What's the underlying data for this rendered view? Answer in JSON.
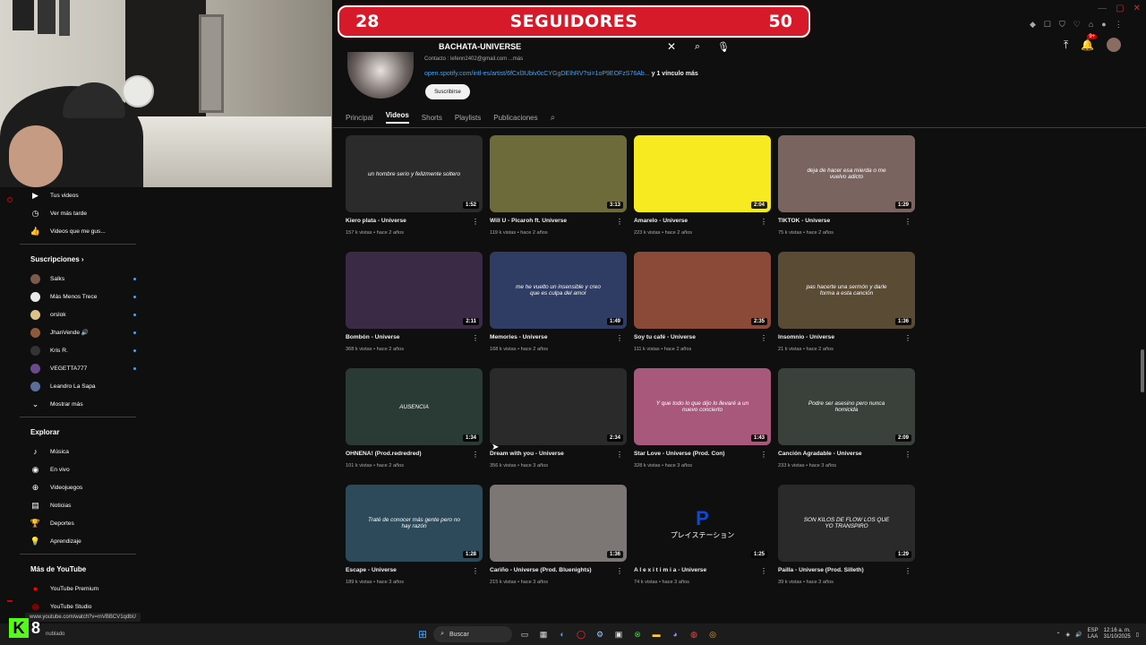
{
  "counter": {
    "left": "28",
    "label": "SEGUIDORES",
    "right": "50"
  },
  "search": {
    "query": "BACHATA-UNIVERSE"
  },
  "notifications": {
    "badge": "9+"
  },
  "channel": {
    "contact": "Contacto : lefenn2402@gmail.com ...más",
    "link": "open.spotify.com/intl-es/artist/6fCxl3Ubiv0cCYGgDEIhRV?si=1oP9EOFzS76Ab...",
    "link_more": "y 1 vínculo más",
    "subscribe_label": "Suscribirse"
  },
  "tabs": [
    "Principal",
    "Videos",
    "Shorts",
    "Playlists",
    "Publicaciones"
  ],
  "sidebar": {
    "you_items": [
      {
        "icon": "your-videos-icon",
        "label": "Tus videos"
      },
      {
        "icon": "watch-later-icon",
        "label": "Ver más tarde"
      },
      {
        "icon": "liked-videos-icon",
        "label": "Videos que me gus..."
      }
    ],
    "subs_header": "Suscripciones  ›",
    "subscriptions": [
      {
        "label": "Salks",
        "color": "#7b5b4a"
      },
      {
        "label": "Más Menos Trece",
        "color": "#e8e8e8"
      },
      {
        "label": "orslok",
        "color": "#d8c48a"
      },
      {
        "label": "JhanVende 🔊",
        "color": "#8c5a3c"
      },
      {
        "label": "Kris R.",
        "color": "#333"
      },
      {
        "label": "VEGETTA777",
        "color": "#6b4a8c"
      },
      {
        "label": "Leandro La Sapa",
        "color": "#5a6e9a"
      }
    ],
    "show_more": "Mostrar más",
    "explore_header": "Explorar",
    "explore": [
      {
        "icon": "music-icon",
        "label": "Música"
      },
      {
        "icon": "live-icon",
        "label": "En vivo"
      },
      {
        "icon": "gaming-icon",
        "label": "Videojuegos"
      },
      {
        "icon": "news-icon",
        "label": "Noticias"
      },
      {
        "icon": "sports-icon",
        "label": "Deportes"
      },
      {
        "icon": "learning-icon",
        "label": "Aprendizaje"
      }
    ],
    "more_header": "Más de YouTube",
    "more": [
      {
        "icon": "youtube-premium-icon",
        "label": "YouTube Premium"
      },
      {
        "icon": "youtube-studio-icon",
        "label": "YouTube Studio"
      }
    ]
  },
  "videos": [
    {
      "title": "Kiero plata - Universe",
      "meta": "157 k vistas • hace 2 años",
      "dur": "1:52",
      "text": "un hombre serio y felizmente soltero",
      "bg": "#2b2b2b"
    },
    {
      "title": "Will U - Picaroh ft. Universe",
      "meta": "119 k vistas • hace 2 años",
      "dur": "3:13",
      "text": "",
      "bg": "#6d6b3a"
    },
    {
      "title": "Amarelo - Universe",
      "meta": "223 k vistas • hace 2 años",
      "dur": "2:04",
      "text": "",
      "bg": "#f7ea21"
    },
    {
      "title": "TIKTOK - Universe",
      "meta": "75 k vistas • hace 2 años",
      "dur": "1:29",
      "text": "deja de hacer esa mierda o me vuelvo adicto",
      "bg": "#7a6460"
    },
    {
      "title": "Bombón - Universe",
      "meta": "368 k vistas • hace 2 años",
      "dur": "2:11",
      "text": "",
      "bg": "#3a2a45"
    },
    {
      "title": "Memories - Universe",
      "meta": "168 k vistas • hace 2 años",
      "dur": "1:49",
      "text": "me he vuelto un insensible y creo que es culpa del amor",
      "bg": "#2f3c63"
    },
    {
      "title": "Soy tu café - Universe",
      "meta": "111 k vistas • hace 2 años",
      "dur": "2:35",
      "text": "",
      "bg": "#8a4a37"
    },
    {
      "title": "Insomnio - Universe",
      "meta": "21 k vistas • hace 2 años",
      "dur": "1:36",
      "text": "pas hacerte una sermón y darle forma a esta canción",
      "bg": "#5a4b35"
    },
    {
      "title": "OHNENA! (Prod.redredred)",
      "meta": "101 k vistas • hace 2 años",
      "dur": "1:34",
      "text": "AUSENCIA",
      "bg": "#2a3a34"
    },
    {
      "title": "Dream with you - Universe",
      "meta": "356 k vistas • hace 3 años",
      "dur": "2:34",
      "text": "",
      "bg": "#2a2a2a"
    },
    {
      "title": "Star Love - Universe (Prod. Con)",
      "meta": "328 k vistas • hace 3 años",
      "dur": "1:43",
      "text": "Y que todo lo que dijo lo llevaré a un nuevo concierto",
      "bg": "#a8587a"
    },
    {
      "title": "Canción Agradable - Universe",
      "meta": "233 k vistas • hace 3 años",
      "dur": "2:09",
      "text": "Podre ser asesino pero nunca homicida",
      "bg": "#39413a"
    },
    {
      "title": "Escape - Universe",
      "meta": "189 k vistas • hace 3 años",
      "dur": "1:28",
      "text": "Traté de conocer más gente pero no hay razón",
      "bg": "#2d4a5a"
    },
    {
      "title": "Cariño - Universe (Prod. Bluenights)",
      "meta": "215 k vistas • hace 3 años",
      "dur": "1:36",
      "text": "",
      "bg": "#7c7775"
    },
    {
      "title": "A l e x i t i m i a - Universe",
      "meta": "74 k vistas • hace 3 años",
      "dur": "1:25",
      "text": "プレイステーション",
      "bg": "#0f0f0f"
    },
    {
      "title": "Pailla - Universe (Prod. Silleth)",
      "meta": "39 k vistas • hace 3 años",
      "dur": "1:29",
      "text": "SON KILOS DE FLOW LOS QUE YO TRANSPIRO",
      "bg": "#2a2a2a"
    }
  ],
  "status_url": "www.youtube.com/watch?v=mVBBCV1qdbU",
  "overlay": {
    "k": "K",
    "n": "8",
    "t": "nublado"
  },
  "taskbar": {
    "search_label": "Buscar",
    "lang_top": "ESP",
    "lang_bottom": "LAA",
    "time": "12:16 a. m.",
    "date": "31/10/2025"
  }
}
